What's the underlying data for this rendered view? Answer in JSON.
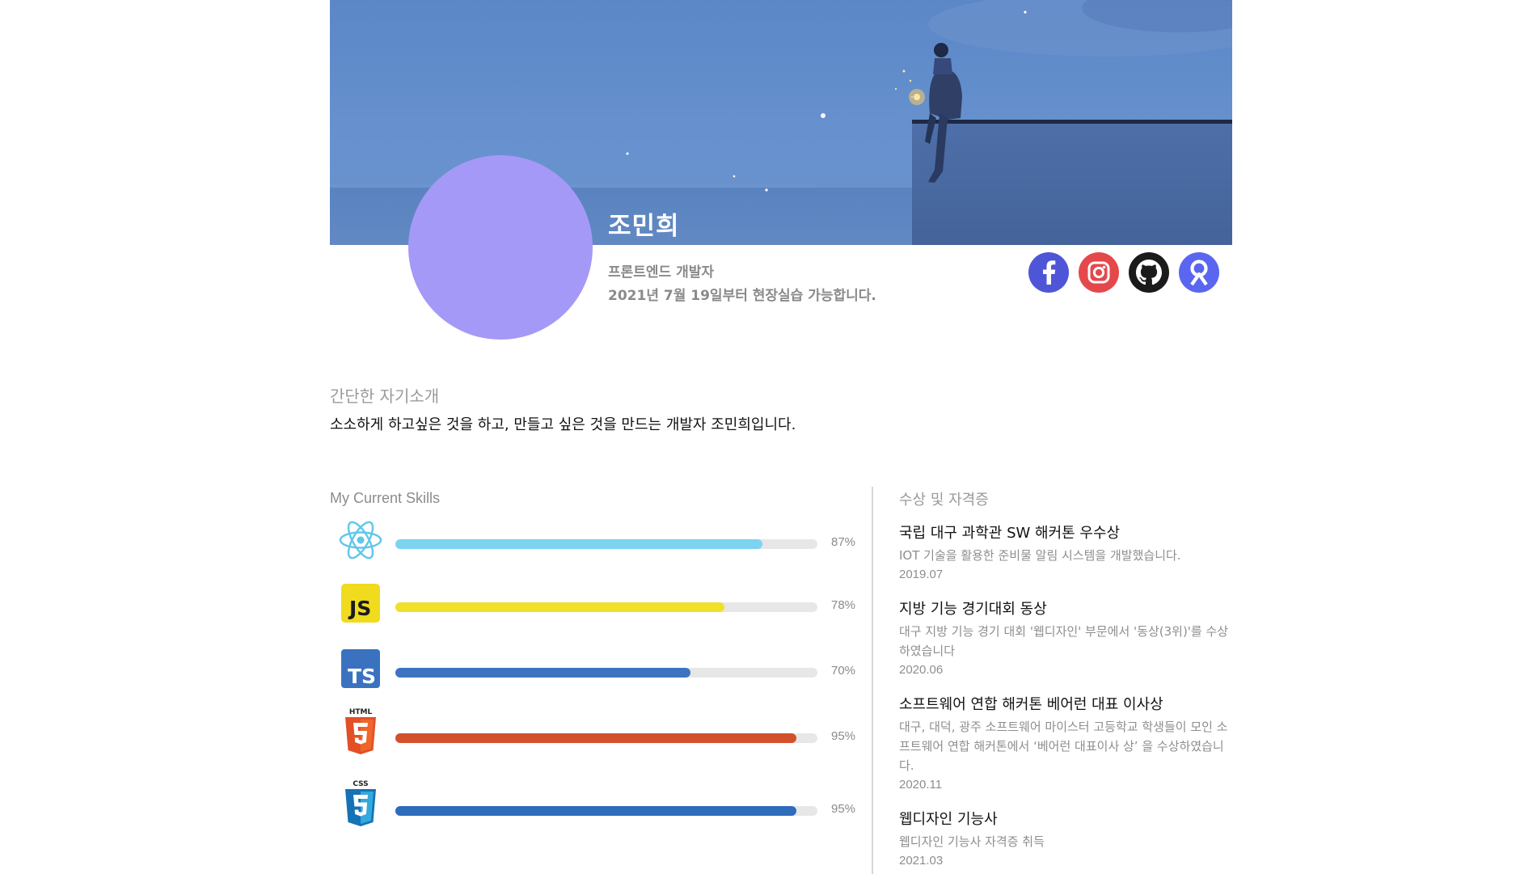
{
  "profile": {
    "name": "조민희",
    "role": "프론트엔드 개발자",
    "availability": "2021년 7월 19일부터 현장실습 가능합니다."
  },
  "socials": [
    {
      "name": "facebook-icon",
      "color": "#4e55d6"
    },
    {
      "name": "instagram-icon",
      "color": "#e5484b"
    },
    {
      "name": "github-icon",
      "color": "#1b1b1b"
    },
    {
      "name": "rocketpunch-icon",
      "color": "#5a66f0"
    }
  ],
  "intro": {
    "heading": "간단한 자기소개",
    "text": "소소하게 하고싶은 것을 하고, 만들고 싶은 것을 만드는 개발자 조민희입니다."
  },
  "skills": {
    "heading": "My Current Skills",
    "items": [
      {
        "icon": "react-icon",
        "percent": 87,
        "label": "87%",
        "color": "#7dd3f0"
      },
      {
        "icon": "javascript-icon",
        "percent": 78,
        "label": "78%",
        "color": "#f0e02a"
      },
      {
        "icon": "typescript-icon",
        "percent": 70,
        "label": "70%",
        "color": "#3d74c2"
      },
      {
        "icon": "html5-icon",
        "percent": 95,
        "label": "95%",
        "color": "#d2512b"
      },
      {
        "icon": "css3-icon",
        "percent": 95,
        "label": "95%",
        "color": "#2f6bbb"
      }
    ]
  },
  "awards": {
    "heading": "수상 및 자격증",
    "items": [
      {
        "title": "국립 대구 과학관 SW 해커톤 우수상",
        "desc": "IOT 기술을 활용한 준비물 알림 시스템을 개발했습니다.",
        "date": "2019.07"
      },
      {
        "title": "지방 기능 경기대회 동상",
        "desc": "대구 지방 기능 경기 대회 '웹디자인' 부문에서 '동상(3위)'를 수상하였습니다",
        "date": "2020.06"
      },
      {
        "title": "소프트웨어 연합 해커톤 베어런 대표 이사상",
        "desc": "대구, 대덕, 광주 소프트웨어 마이스터 고등학교 학생들이 모인 소프트웨어 연합 해커톤에서 ‘베어런 대표이사 상’ 을 수상하였습니다.",
        "date": "2020.11"
      },
      {
        "title": "웹디자인 기능사",
        "desc": "웹디자인 기능사 자격증 취득",
        "date": "2021.03"
      }
    ]
  }
}
